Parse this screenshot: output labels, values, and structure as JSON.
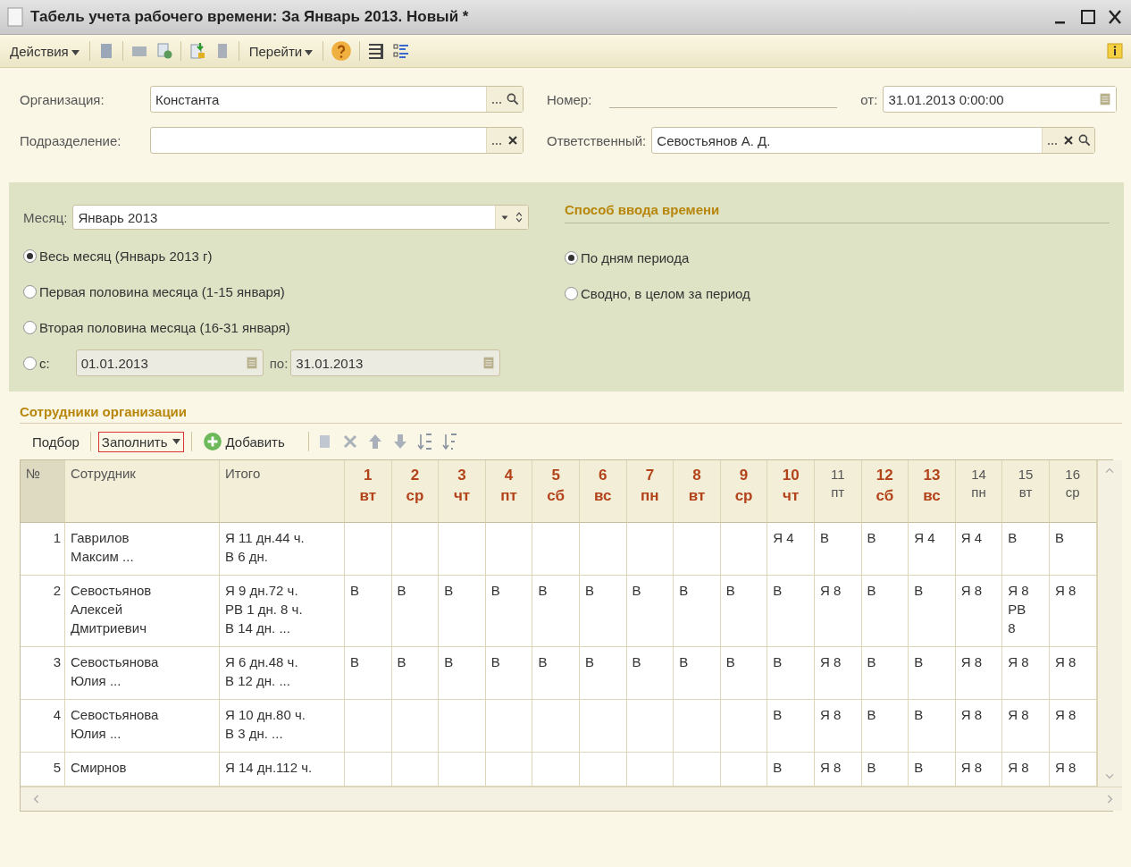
{
  "window": {
    "title": "Табель учета рабочего времени: За Январь 2013. Новый *"
  },
  "toolbar": {
    "actions_menu": "Действия",
    "goto_menu": "Перейти"
  },
  "header": {
    "organization": {
      "label": "Организация:",
      "value": "Константа"
    },
    "subdivision": {
      "label": "Подразделение:"
    },
    "number": {
      "label": "Номер:"
    },
    "date": {
      "label": "от:",
      "value": "31.01.2013  0:00:00"
    },
    "responsible": {
      "label": "Ответственный:",
      "value": "Севостьянов А. Д."
    }
  },
  "period": {
    "month": {
      "label": "Месяц:",
      "value": "Январь 2013"
    },
    "options": [
      {
        "label": "Весь месяц (Январь 2013 г)",
        "selected": true
      },
      {
        "label": "Первая половина месяца (1-15 января)",
        "selected": false
      },
      {
        "label": "Вторая половина месяца (16-31 января)",
        "selected": false
      },
      {
        "label": "с:",
        "selected": false
      }
    ],
    "range": {
      "from": "01.01.2013",
      "to_label": "по:",
      "to": "31.01.2013"
    }
  },
  "input_method": {
    "title": "Способ ввода времени",
    "options": [
      {
        "label": "По дням периода",
        "selected": true
      },
      {
        "label": "Сводно, в целом за период",
        "selected": false
      }
    ]
  },
  "employees": {
    "title": "Сотрудники организации",
    "pick": "Подбор",
    "fill": "Заполнить",
    "add": "Добавить",
    "columns": {
      "number": "№",
      "employee": "Сотрудник",
      "total": "Итого"
    },
    "days": [
      {
        "num": "1",
        "weekday": "вт",
        "holiday": true
      },
      {
        "num": "2",
        "weekday": "ср",
        "holiday": true
      },
      {
        "num": "3",
        "weekday": "чт",
        "holiday": true
      },
      {
        "num": "4",
        "weekday": "пт",
        "holiday": true
      },
      {
        "num": "5",
        "weekday": "сб",
        "holiday": true
      },
      {
        "num": "6",
        "weekday": "вс",
        "holiday": true
      },
      {
        "num": "7",
        "weekday": "пн",
        "holiday": true
      },
      {
        "num": "8",
        "weekday": "вт",
        "holiday": true
      },
      {
        "num": "9",
        "weekday": "ср",
        "holiday": true
      },
      {
        "num": "10",
        "weekday": "чт",
        "holiday": true
      },
      {
        "num": "11",
        "weekday": "пт",
        "holiday": false
      },
      {
        "num": "12",
        "weekday": "сб",
        "holiday": true
      },
      {
        "num": "13",
        "weekday": "вс",
        "holiday": true
      },
      {
        "num": "14",
        "weekday": "пн",
        "holiday": false
      },
      {
        "num": "15",
        "weekday": "вт",
        "holiday": false
      },
      {
        "num": "16",
        "weekday": "ср",
        "holiday": false
      }
    ],
    "rows": [
      {
        "number": "1",
        "name": [
          "Гаврилов",
          "Максим ..."
        ],
        "total": [
          "Я 11 дн.44 ч.",
          "В 6 дн."
        ],
        "cells": [
          null,
          null,
          null,
          null,
          null,
          null,
          null,
          null,
          null,
          "Я 4",
          "В",
          "В",
          "Я 4",
          "Я 4",
          "В",
          "В"
        ]
      },
      {
        "number": "2",
        "name": [
          "Севостьянов",
          "Алексей",
          "Дмитриевич"
        ],
        "total": [
          "Я 9 дн.72 ч.",
          "РВ 1 дн. 8 ч.",
          "В 14 дн. ..."
        ],
        "cells": [
          "В",
          "В",
          "В",
          "В",
          "В",
          "В",
          "В",
          "В",
          "В",
          "В",
          "Я 8",
          "В",
          "В",
          "Я 8",
          "Я 8\nРВ\n8",
          "Я 8"
        ]
      },
      {
        "number": "3",
        "name": [
          "Севостьянова",
          "Юлия ..."
        ],
        "total": [
          "Я 6 дн.48 ч.",
          "В 12 дн. ..."
        ],
        "cells": [
          "В",
          "В",
          "В",
          "В",
          "В",
          "В",
          "В",
          "В",
          "В",
          "В",
          "Я 8",
          "В",
          "В",
          "Я 8",
          "Я 8",
          "Я 8"
        ]
      },
      {
        "number": "4",
        "name": [
          "Севостьянова",
          "Юлия ..."
        ],
        "total": [
          "Я 10 дн.80 ч.",
          "В 3 дн. ..."
        ],
        "cells": [
          null,
          null,
          null,
          null,
          null,
          null,
          null,
          null,
          null,
          "В",
          "Я 8",
          "В",
          "В",
          "Я 8",
          "Я 8",
          "Я 8"
        ]
      },
      {
        "number": "5",
        "name": [
          "Смирнов"
        ],
        "total": [
          "Я 14 дн.112 ч."
        ],
        "cells": [
          null,
          null,
          null,
          null,
          null,
          null,
          null,
          null,
          null,
          "В",
          "Я 8",
          "В",
          "В",
          "Я 8",
          "Я 8",
          "Я 8"
        ]
      }
    ]
  }
}
